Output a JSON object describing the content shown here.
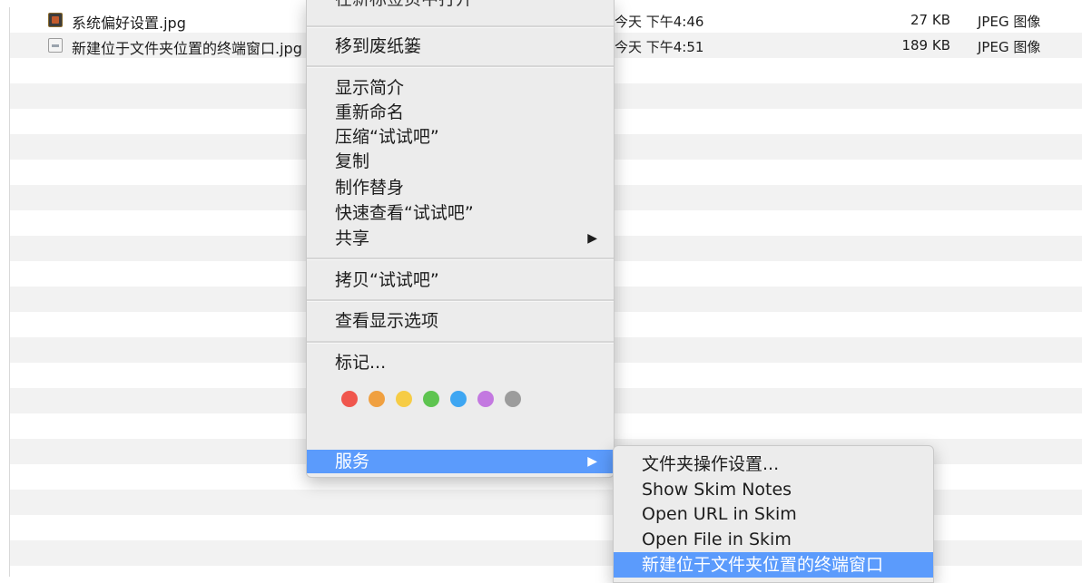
{
  "files": [
    {
      "name": "系统偏好设置.jpg",
      "date": "今天 下午4:46",
      "size": "27 KB",
      "kind": "JPEG 图像",
      "icon": "prefs-thumbnail-icon"
    },
    {
      "name": "新建位于文件夹位置的终端窗口.jpg",
      "date": "今天 下午4:51",
      "size": "189 KB",
      "kind": "JPEG 图像",
      "icon": "image-thumbnail-icon"
    }
  ],
  "context_menu": {
    "cut_top_label": "在新标签页中打开",
    "move_to_trash": "移到废纸篓",
    "get_info": "显示简介",
    "rename": "重新命名",
    "compress": "压缩“试试吧”",
    "duplicate": "复制",
    "make_alias": "制作替身",
    "quick_look": "快速查看“试试吧”",
    "share": "共享",
    "copy_item": "拷贝“试试吧”",
    "show_view_options": "查看显示选项",
    "tags": "标记...",
    "tag_colors": [
      "#f0564d",
      "#f0a040",
      "#f6cc45",
      "#5ec450",
      "#3ea6f2",
      "#c378e0",
      "#9c9c9c"
    ],
    "services": "服务",
    "submenu_arrow": "▶"
  },
  "services_submenu": {
    "items": [
      "文件夹操作设置...",
      "Show Skim Notes",
      "Open URL in Skim",
      "Open File in Skim",
      "新建位于文件夹位置的终端窗口"
    ]
  },
  "colors": {
    "highlight": "#5b9bfc",
    "menu_bg": "#ececec"
  }
}
